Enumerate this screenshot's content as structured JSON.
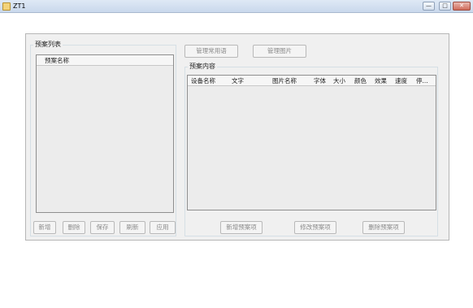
{
  "window": {
    "title": "ZT1",
    "min_label": "—",
    "max_label": "□",
    "close_label": "✕"
  },
  "left": {
    "group_title": "预案列表",
    "column": "预案名称",
    "buttons": [
      "新增",
      "删除",
      "保存",
      "刷新",
      "应用"
    ]
  },
  "top_buttons": [
    "管理常用语",
    "管理图片"
  ],
  "right": {
    "group_title": "预案内容",
    "columns": [
      "设备名称",
      "文字",
      "图片名称",
      "字体",
      "大小",
      "颜色",
      "效果",
      "速度",
      "停..."
    ],
    "buttons": [
      "新增预案项",
      "修改预案项",
      "删除预案项"
    ]
  }
}
